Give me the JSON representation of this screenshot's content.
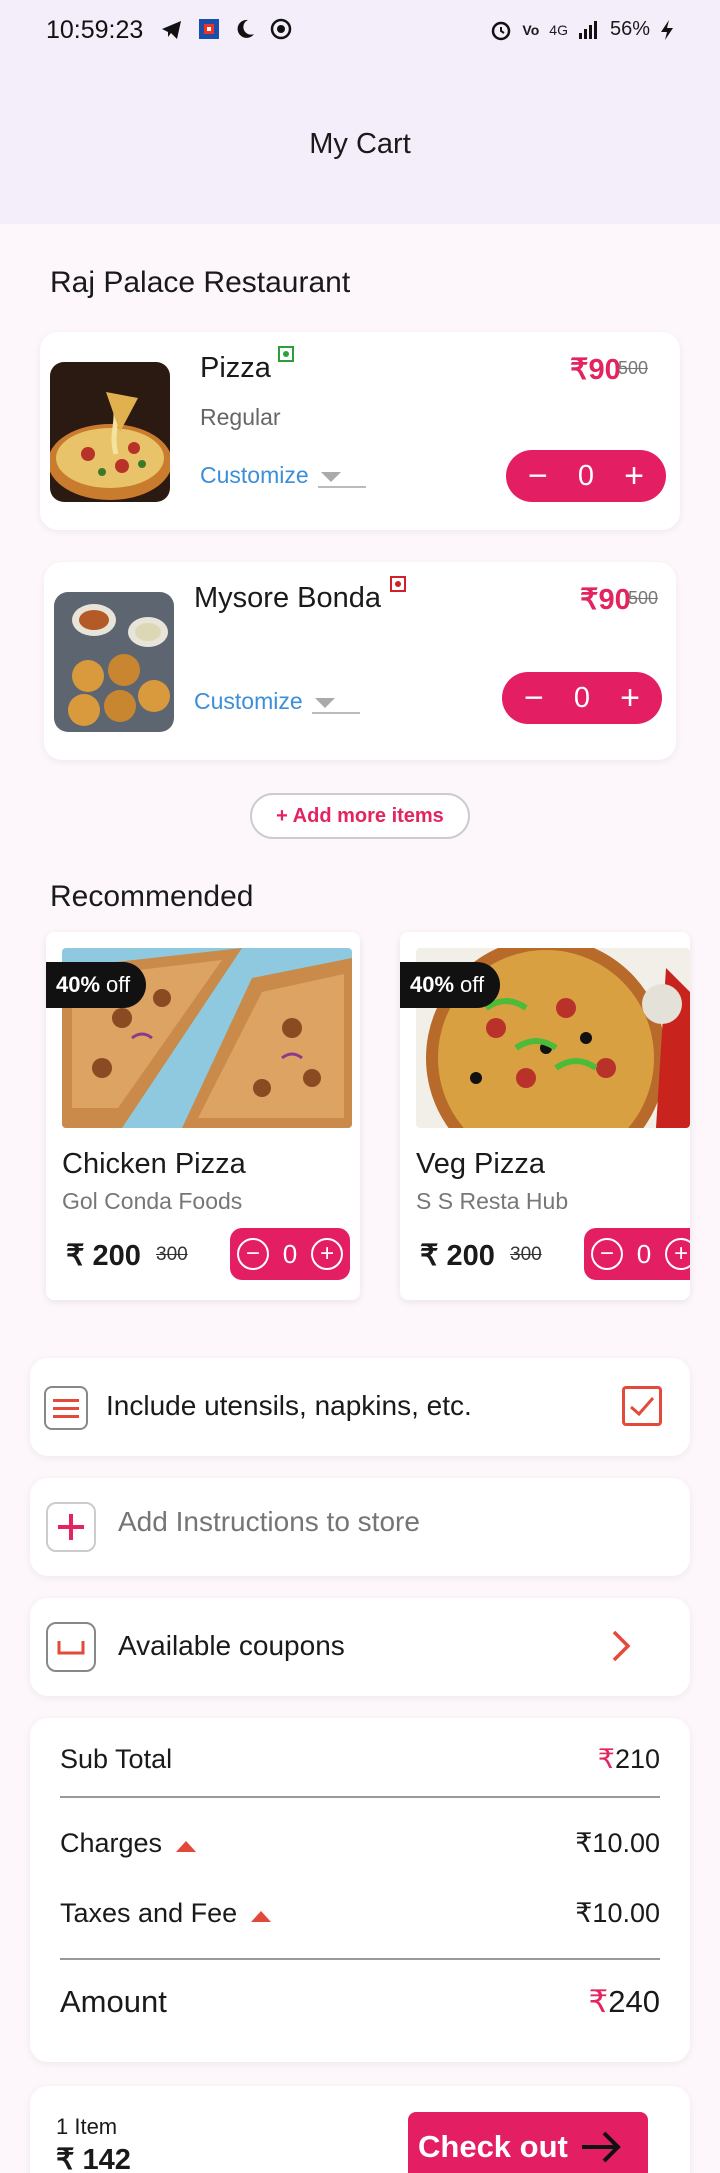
{
  "status": {
    "time": "10:59:23",
    "battery": "56%",
    "network": "4G"
  },
  "header": {
    "title": "My Cart"
  },
  "restaurant": {
    "name": "Raj Palace Restaurant"
  },
  "cart_items": [
    {
      "name": "Pizza",
      "variant": "Regular",
      "customize": "Customize",
      "price": "₹90",
      "old_price": "500",
      "qty": "0",
      "veg": true
    },
    {
      "name": "Mysore Bonda",
      "variant": "",
      "customize": "Customize",
      "price": "₹90",
      "old_price": "500",
      "qty": "0",
      "veg": false
    }
  ],
  "add_more": "+ Add more items",
  "recommended": {
    "title": "Recommended",
    "items": [
      {
        "discount_pct": "40%",
        "discount_word": "off",
        "name": "Chicken Pizza",
        "store": "Gol Conda Foods",
        "price": "₹ 200",
        "old_price": "300",
        "qty": "0"
      },
      {
        "discount_pct": "40%",
        "discount_word": "off",
        "name": "Veg Pizza",
        "store": "S S Resta Hub",
        "price": "₹ 200",
        "old_price": "300",
        "qty": "0"
      }
    ]
  },
  "options": {
    "utensils": "Include utensils, napkins, etc.",
    "utensils_checked": true,
    "instructions_placeholder": "Add Instructions to store",
    "coupons": "Available coupons"
  },
  "summary": {
    "subtotal_label": "Sub Total",
    "subtotal_symbol": "₹",
    "subtotal_value": "210",
    "charges_label": "Charges",
    "charges_value": "₹10.00",
    "taxes_label": "Taxes and Fee",
    "taxes_value": "₹10.00",
    "amount_label": "Amount",
    "amount_symbol": "₹",
    "amount_value": "240"
  },
  "checkout": {
    "count": "1 Item",
    "total": "₹ 142",
    "button": "Check out"
  },
  "colors": {
    "accent": "#e41e63",
    "link": "#3b8fd9",
    "orange": "#e34a3a",
    "header_bg": "#f4eefa"
  }
}
